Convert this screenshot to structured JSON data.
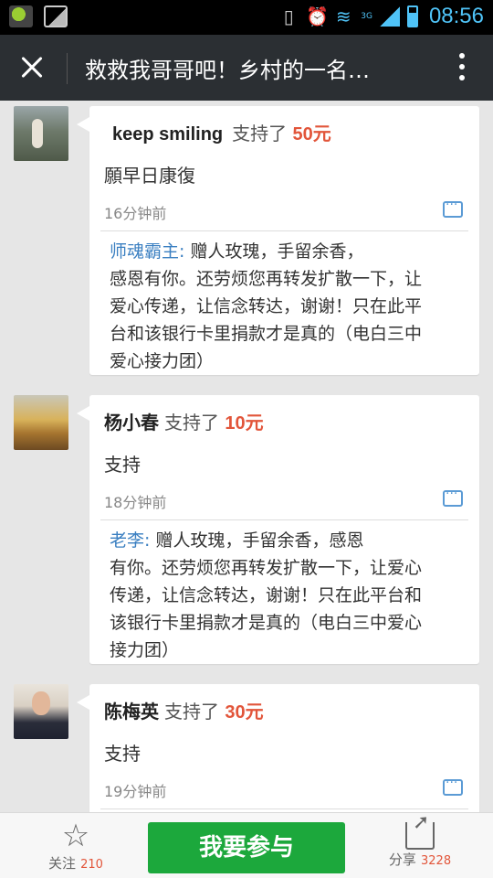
{
  "status_bar": {
    "network": "3G",
    "time": "08:56"
  },
  "title_bar": {
    "title": "救救我哥哥吧！乡村的一名…"
  },
  "comments": [
    {
      "name": "keep smiling",
      "label": "支持了",
      "amount": "50元",
      "message": "願早日康復",
      "time": "16分钟前",
      "reply_name": "师魂霸主:",
      "reply_lines": [
        " 赠人玫瑰，手留余香，",
        "感恩有你。还劳烦您再转发扩散一下，让",
        "爱心传递，让信念转达，谢谢！只在此平",
        "台和该银行卡里捐款才是真的（电白三中",
        "爱心接力团）"
      ]
    },
    {
      "name": "杨小春",
      "label": "支持了",
      "amount": "10元",
      "message": "支持",
      "time": "18分钟前",
      "reply_name": "老李:",
      "reply_lines": [
        " 赠人玫瑰，手留余香，感恩",
        "有你。还劳烦您再转发扩散一下，让爱心",
        "传递，让信念转达，谢谢！只在此平台和",
        "该银行卡里捐款才是真的（电白三中爱心",
        "接力团）"
      ]
    },
    {
      "name": "陈梅英",
      "label": "支持了",
      "amount": "30元",
      "message": "支持",
      "time": "19分钟前"
    }
  ],
  "bottom_bar": {
    "follow_label": "关注",
    "follow_count": "210",
    "join_label": "我要参与",
    "share_label": "分享",
    "share_count": "3228"
  },
  "colors": {
    "amount": "#e2553a",
    "reply_name": "#3a7fc1",
    "join_button": "#1ca83c",
    "title_bar": "#2b2f33"
  }
}
